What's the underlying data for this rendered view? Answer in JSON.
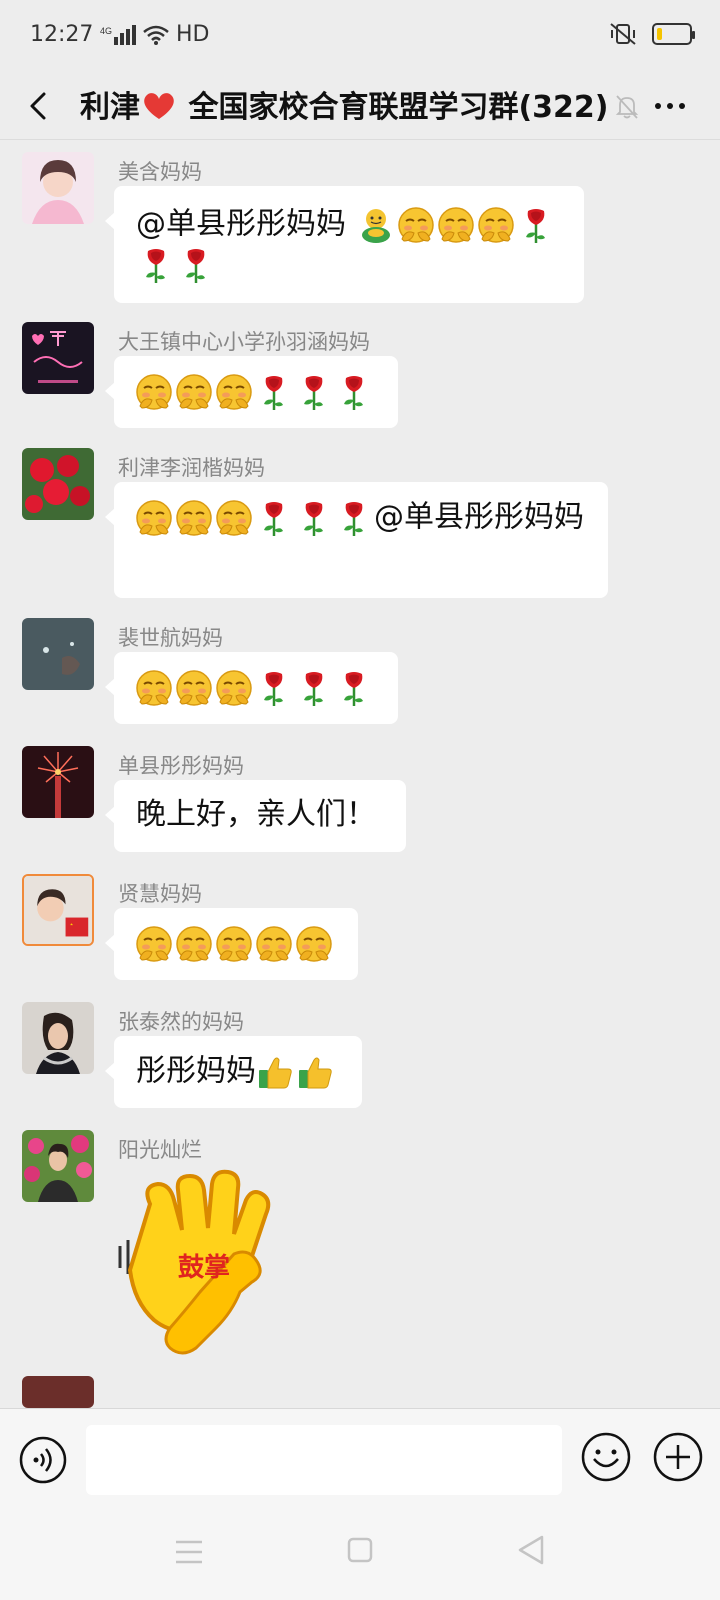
{
  "status_bar": {
    "time": "12:27",
    "network": "4G",
    "hd": "HD",
    "battery_level": 0.15
  },
  "header": {
    "title_prefix": "利津",
    "title_suffix": " 全国家校合育联盟学习群(322)",
    "heart_icon": "red-heart-icon",
    "mute_icon": "bell-muted-icon",
    "more_icon": "more-icon"
  },
  "messages": [
    {
      "sender": "美含妈妈",
      "text_start": "@单县彤彤妈妈 ",
      "emojis": [
        "frog-hug",
        "shy",
        "shy",
        "shy",
        "rose",
        "rose",
        "rose"
      ]
    },
    {
      "sender": "大王镇中心小学孙羽涵妈妈",
      "emojis": [
        "shy",
        "shy",
        "shy",
        "rose",
        "rose",
        "rose"
      ]
    },
    {
      "sender": "利津李润楷妈妈",
      "text_end": "@单县彤彤妈妈",
      "emojis": [
        "shy",
        "shy",
        "shy",
        "rose",
        "rose",
        "rose"
      ]
    },
    {
      "sender": "裴世航妈妈",
      "emojis": [
        "shy",
        "shy",
        "shy",
        "rose",
        "rose",
        "rose"
      ]
    },
    {
      "sender": "单县彤彤妈妈",
      "text": "晚上好，亲人们！"
    },
    {
      "sender": "贤慧妈妈",
      "emojis": [
        "shy",
        "shy",
        "shy",
        "shy",
        "shy"
      ]
    },
    {
      "sender": "张泰然的妈妈",
      "text_start": "彤彤妈妈",
      "emojis": [
        "thumbs-up",
        "thumbs-up"
      ]
    },
    {
      "sender": "阳光灿烂",
      "sticker_text": "鼓掌",
      "sticker_icon": "clapping-hands-sticker"
    }
  ],
  "input_bar": {
    "voice_icon": "voice-icon",
    "emoji_icon": "emoji-icon",
    "plus_icon": "plus-icon"
  },
  "nav_bar": {
    "menu_icon": "menu-icon",
    "home_icon": "home-icon",
    "back_icon": "back-triangle-icon"
  }
}
